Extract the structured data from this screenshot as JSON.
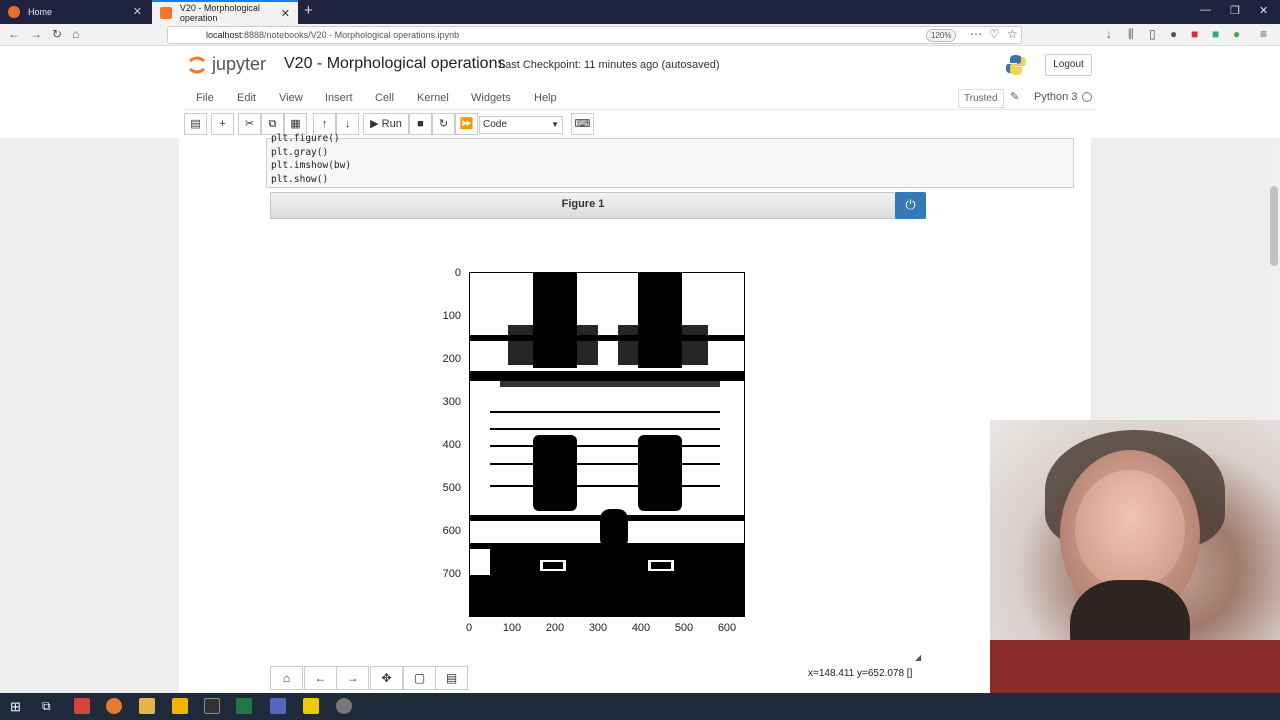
{
  "browser": {
    "tabs": [
      {
        "label": "Home"
      },
      {
        "label": "V20 - Morphological operation"
      }
    ],
    "url_host": "localhost",
    "url_rest": ":8888/notebooks/V20 - Morphological operations.ipynb",
    "zoom": "120%"
  },
  "jupyter": {
    "logo_text": "jupyter",
    "notebook_title": "V20 - Morphological operations",
    "checkpoint": "Last Checkpoint: 11 minutes ago  (autosaved)",
    "logout_label": "Logout",
    "menus": [
      "File",
      "Edit",
      "View",
      "Insert",
      "Cell",
      "Kernel",
      "Widgets",
      "Help"
    ],
    "trusted_label": "Trusted",
    "kernel_name": "Python 3",
    "run_label": "Run",
    "cell_type": "Code"
  },
  "code_cell": {
    "lines": [
      "plt.figure()",
      "plt.gray()",
      "plt.imshow(bw)",
      "plt.show()"
    ]
  },
  "figure": {
    "title": "Figure 1",
    "coords_readout": "x=148.411 y=652.078 []",
    "y_ticks": [
      "0",
      "100",
      "200",
      "300",
      "400",
      "500",
      "600",
      "700"
    ],
    "x_ticks": [
      "0",
      "100",
      "200",
      "300",
      "400",
      "500",
      "600"
    ]
  },
  "chart_data": {
    "type": "heatmap",
    "title": "",
    "xlabel": "",
    "ylabel": "",
    "xlim": [
      0,
      640
    ],
    "ylim": [
      800,
      0
    ],
    "x_ticks": [
      0,
      100,
      200,
      300,
      400,
      500,
      600
    ],
    "y_ticks": [
      0,
      100,
      200,
      300,
      400,
      500,
      600,
      700
    ],
    "colormap": "gray"
  },
  "colors": {
    "tabstrip": "#202340",
    "accent": "#0a84ff",
    "jupyter_orange": "#f37726",
    "power_button": "#337ab7"
  }
}
